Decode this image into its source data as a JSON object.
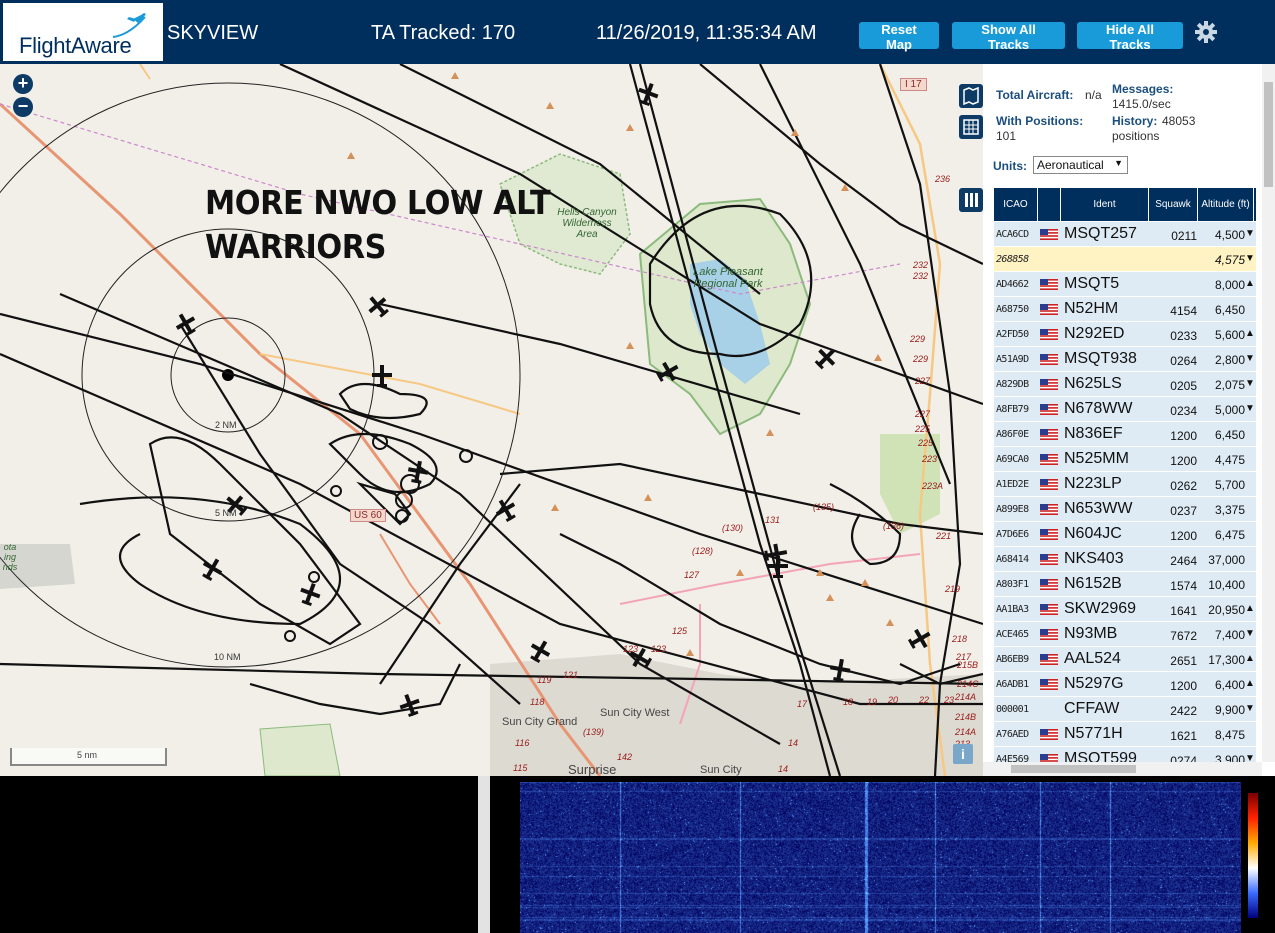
{
  "header": {
    "logo_text": "FlightAware",
    "app_name": "SKYVIEW",
    "tracked": "TA Tracked: 170",
    "datetime": "11/26/2019, 11:35:34 AM",
    "buttons": {
      "reset": "Reset Map",
      "show": "Show All Tracks",
      "hide": "Hide All Tracks"
    }
  },
  "map": {
    "annotation_line1": "MORE NWO LOW ALT",
    "annotation_line2": "WARRIORS",
    "zoom_in": "+",
    "zoom_out": "−",
    "scale_label": "5 nm",
    "info_label": "i",
    "range_rings": [
      "2 NM",
      "5 NM",
      "10 NM"
    ],
    "places": [
      "Sun City Grand",
      "Sun City West",
      "Surprise",
      "Sun City"
    ],
    "park_labels": {
      "lake_pleasant": "Lake Pleasant Regional Park",
      "hells_canyon": "Hells Canyon Wilderness Area",
      "left_area": "ota ing nds"
    },
    "highway_labels": {
      "us60": "US 60",
      "i17": "I 17"
    },
    "road_numbers": [
      "236",
      "232",
      "232",
      "229",
      "229",
      "227",
      "227",
      "225",
      "225",
      "223",
      "223A",
      "221",
      "219",
      "218",
      "217",
      "215B",
      "214C",
      "214A",
      "214B",
      "214A",
      "213",
      "(135)",
      "(136)",
      "(130)",
      "(128)",
      "127",
      "131",
      "125",
      "123",
      "123",
      "121",
      "119",
      "118",
      "116",
      "115",
      "(139)",
      "142",
      "17",
      "18",
      "19",
      "20",
      "22",
      "23",
      "14",
      "14"
    ]
  },
  "sidebar": {
    "stats": {
      "total_label": "Total Aircraft:",
      "total_value": "n/a",
      "positions_label": "With Positions:",
      "positions_value": "101",
      "messages_label": "Messages:",
      "messages_value": "1415.0/sec",
      "history_label": "History:",
      "history_value": "48053 positions"
    },
    "units_label": "Units:",
    "units_value": "Aeronautical",
    "table_headers": {
      "icao": "ICAO",
      "ident": "Ident",
      "squawk": "Squawk",
      "altitude": "Altitude (ft)"
    },
    "rows": [
      {
        "icao": "ACA6CD",
        "flag": true,
        "ident": "MSQT257",
        "squawk": "0211",
        "alt": "4,500",
        "trend": "▼"
      },
      {
        "icao": "268858",
        "flag": false,
        "ident": "",
        "squawk": "",
        "alt": "4,575",
        "trend": "▼",
        "selected": true
      },
      {
        "icao": "AD4662",
        "flag": true,
        "ident": "MSQT5",
        "squawk": "",
        "alt": "8,000",
        "trend": "▲"
      },
      {
        "icao": "A68750",
        "flag": true,
        "ident": "N52HM",
        "squawk": "4154",
        "alt": "6,450",
        "trend": ""
      },
      {
        "icao": "A2FD50",
        "flag": true,
        "ident": "N292ED",
        "squawk": "0233",
        "alt": "5,600",
        "trend": "▲"
      },
      {
        "icao": "A51A9D",
        "flag": true,
        "ident": "MSQT938",
        "squawk": "0264",
        "alt": "2,800",
        "trend": "▼"
      },
      {
        "icao": "A829DB",
        "flag": true,
        "ident": "N625LS",
        "squawk": "0205",
        "alt": "2,075",
        "trend": "▼"
      },
      {
        "icao": "A8FB79",
        "flag": true,
        "ident": "N678WW",
        "squawk": "0234",
        "alt": "5,000",
        "trend": "▼"
      },
      {
        "icao": "A86F0E",
        "flag": true,
        "ident": "N836EF",
        "squawk": "1200",
        "alt": "6,450",
        "trend": ""
      },
      {
        "icao": "A69CA0",
        "flag": true,
        "ident": "N525MM",
        "squawk": "1200",
        "alt": "4,475",
        "trend": ""
      },
      {
        "icao": "A1ED2E",
        "flag": true,
        "ident": "N223LP",
        "squawk": "0262",
        "alt": "5,700",
        "trend": ""
      },
      {
        "icao": "A899E8",
        "flag": true,
        "ident": "N653WW",
        "squawk": "0237",
        "alt": "3,375",
        "trend": ""
      },
      {
        "icao": "A7D6E6",
        "flag": true,
        "ident": "N604JC",
        "squawk": "1200",
        "alt": "6,475",
        "trend": ""
      },
      {
        "icao": "A68414",
        "flag": true,
        "ident": "NKS403",
        "squawk": "2464",
        "alt": "37,000",
        "trend": ""
      },
      {
        "icao": "A803F1",
        "flag": true,
        "ident": "N6152B",
        "squawk": "1574",
        "alt": "10,400",
        "trend": ""
      },
      {
        "icao": "AA1BA3",
        "flag": true,
        "ident": "SKW2969",
        "squawk": "1641",
        "alt": "20,950",
        "trend": "▲"
      },
      {
        "icao": "ACE465",
        "flag": true,
        "ident": "N93MB",
        "squawk": "7672",
        "alt": "7,400",
        "trend": "▼"
      },
      {
        "icao": "AB6EB9",
        "flag": true,
        "ident": "AAL524",
        "squawk": "2651",
        "alt": "17,300",
        "trend": "▲"
      },
      {
        "icao": "A6ADB1",
        "flag": true,
        "ident": "N5297G",
        "squawk": "1200",
        "alt": "6,400",
        "trend": "▲"
      },
      {
        "icao": "000001",
        "flag": false,
        "ident": "CFFAW",
        "squawk": "2422",
        "alt": "9,900",
        "trend": "▼"
      },
      {
        "icao": "A76AED",
        "flag": true,
        "ident": "N5771H",
        "squawk": "1621",
        "alt": "8,475",
        "trend": ""
      },
      {
        "icao": "A4E569",
        "flag": true,
        "ident": "MSQT599",
        "squawk": "0274",
        "alt": "3,900",
        "trend": "▼"
      }
    ]
  },
  "colors": {
    "header": "#002f5d",
    "button": "#1a9bd9",
    "row": "#deebf5",
    "row_selected": "#fff3c4"
  }
}
